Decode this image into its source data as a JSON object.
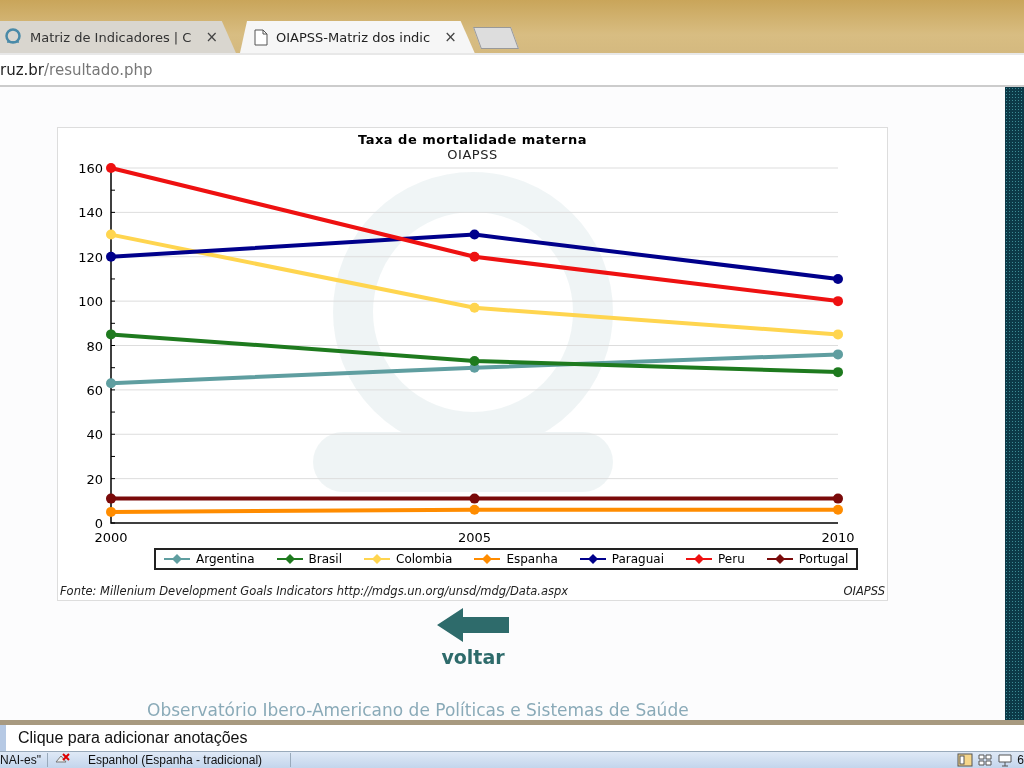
{
  "browser": {
    "tabs": [
      {
        "title": "Matriz de Indicadores | C",
        "selected": false,
        "close": "×"
      },
      {
        "title": "OIAPSS-Matriz dos indic",
        "selected": true,
        "close": "×"
      }
    ],
    "address": {
      "host": "ruz.br",
      "path": "/resultado.php"
    }
  },
  "chart": {
    "chart_data": {
      "type": "line",
      "title": "Taxa de mortalidade materna",
      "subtitle": "OIAPSS",
      "x": [
        2000,
        2005,
        2010
      ],
      "xlim": [
        2000,
        2010
      ],
      "grid": true,
      "xticks": [
        2000,
        2005,
        2010
      ],
      "ylim": [
        0,
        160
      ],
      "yticks": [
        0,
        20,
        40,
        60,
        80,
        100,
        120,
        140,
        160
      ],
      "series": [
        {
          "name": "Argentina",
          "color": "#5f9ea0",
          "marker": "circle",
          "values": [
            63,
            70,
            76
          ]
        },
        {
          "name": "Brasil",
          "color": "#1e7a1e",
          "marker": "circle",
          "values": [
            85,
            73,
            68
          ]
        },
        {
          "name": "Colombia",
          "color": "#ffd54f",
          "marker": "circle",
          "values": [
            130,
            97,
            85
          ]
        },
        {
          "name": "Espanha",
          "color": "#ff8c00",
          "marker": "circle",
          "values": [
            5,
            6,
            6
          ]
        },
        {
          "name": "Paraguai",
          "color": "#00008b",
          "marker": "circle",
          "values": [
            120,
            130,
            110
          ]
        },
        {
          "name": "Peru",
          "color": "#ee1111",
          "marker": "circle",
          "values": [
            160,
            120,
            100
          ]
        },
        {
          "name": "Portugal",
          "color": "#7a0a0a",
          "marker": "circle",
          "values": [
            11,
            11,
            11
          ]
        }
      ]
    },
    "source": "Fonte: Millenium Development Goals Indicators http://mdgs.un.org/unsd/mdg/Data.aspx",
    "credit": "OIAPSS"
  },
  "back_link": {
    "label": "voltar"
  },
  "site_footer": "Observatório Ibero-Americano de Políticas e Sistemas de Saúde",
  "notes": {
    "placeholder": "Clique para adicionar anotações"
  },
  "status_bar": {
    "theme": "NAI-es\"",
    "language": "Espanhol (Espanha - tradicional)",
    "zoom": "6"
  }
}
